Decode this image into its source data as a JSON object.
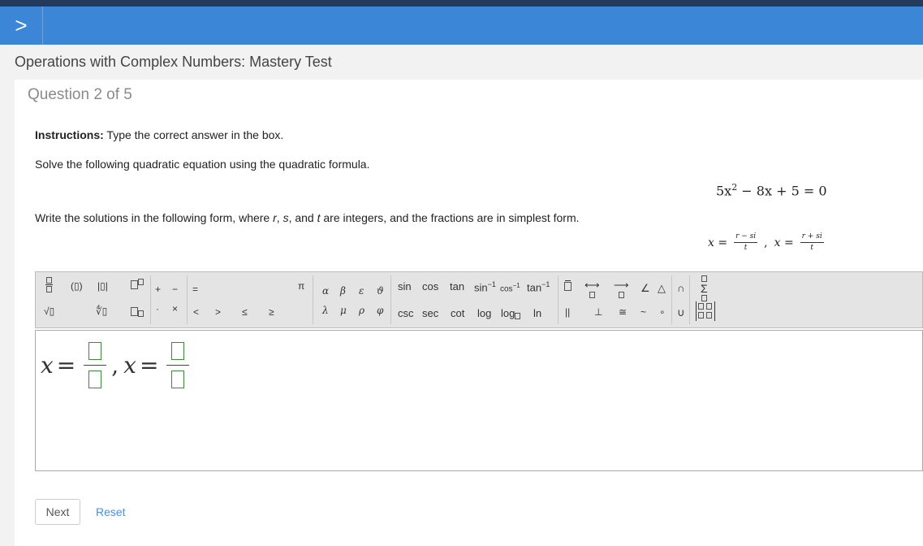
{
  "header": {
    "expand_glyph": ">"
  },
  "test_title": "Operations with Complex Numbers: Mastery Test",
  "question": {
    "number_text": "Question 2 of 5",
    "instructions_label": "Instructions:",
    "instructions_text": "Type the correct answer in the box.",
    "prompt": "Solve the following quadratic equation using the quadratic formula.",
    "equation": {
      "a": "5x",
      "exp": "2",
      "rest": "− 8x + 5 = 0"
    },
    "form_instruction": {
      "pre": "Write the solutions in the following form, where ",
      "r": "r",
      "sep1": ", ",
      "s": "s",
      "sep2": ", and ",
      "t": "t",
      "post": " are integers, and the fractions are in simplest form."
    },
    "form": {
      "x1": "x =",
      "f1_num": "r − si",
      "f1_den": "t",
      "comma": ",",
      "x2": "x =",
      "f2_num": "r + si",
      "f2_den": "t"
    }
  },
  "toolbar": {
    "row1_greek": [
      "α",
      "β",
      "ε",
      "ϑ"
    ],
    "row2_greek": [
      "λ",
      "μ",
      "ρ",
      "φ"
    ],
    "row1_fn": [
      "sin",
      "cos",
      "tan"
    ],
    "inverse_fn": [
      {
        "base": "sin",
        "exp": "−1"
      },
      {
        "base": "cos",
        "exp": "−1"
      },
      {
        "base": "tan",
        "exp": "−1"
      }
    ],
    "row2_fn": [
      "csc",
      "sec",
      "cot",
      "log"
    ],
    "log_sub": "log",
    "ln": "ln",
    "plus": "+",
    "minus": "−",
    "equals": "=",
    "dot": "·",
    "times": "×",
    "lt": "<",
    "gt": ">",
    "le": "≤",
    "ge": "≥",
    "pi": "π",
    "abs": "|▯|",
    "paren": "(▯)",
    "sqrt": "√▯",
    "nthroot": "∜▯",
    "parallel": "||",
    "perp": "⊥",
    "congruent": "≅",
    "similar": "~",
    "degree": "∘",
    "angle": "∠",
    "triangle": "△",
    "intersection": "∩",
    "union": "∪",
    "sigma": "Σ",
    "line_arrow": "⟷",
    "ray_arrow": "⟶"
  },
  "answer": {
    "x1": "x",
    "eq1": "=",
    "comma": ",",
    "x2": "x",
    "eq2": "="
  },
  "actions": {
    "next_label": "Next",
    "reset_label": "Reset"
  }
}
